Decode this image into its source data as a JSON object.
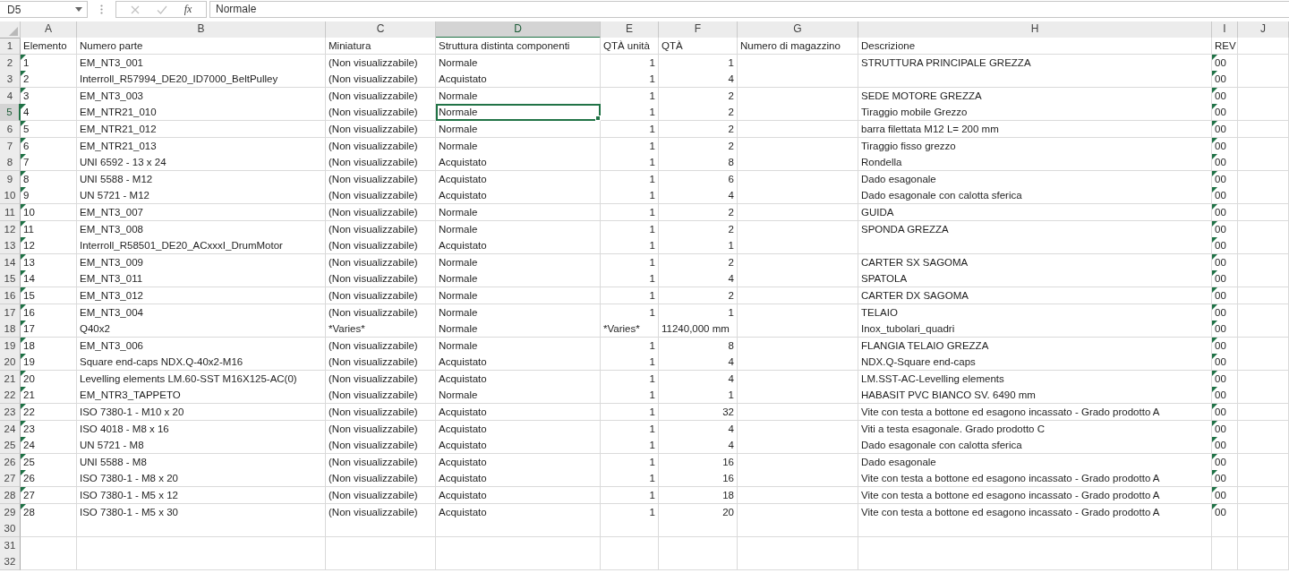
{
  "formula_bar": {
    "name_box": {
      "value": "D5"
    },
    "cancel_button": {
      "disabled": true
    },
    "enter_button": {
      "disabled": true
    },
    "function_button": {
      "label": "fx"
    },
    "formula": {
      "value": "Normale"
    }
  },
  "columns": [
    {
      "label": "A",
      "selected": false
    },
    {
      "label": "B",
      "selected": false
    },
    {
      "label": "C",
      "selected": false
    },
    {
      "label": "D",
      "selected": true
    },
    {
      "label": "E",
      "selected": false
    },
    {
      "label": "F",
      "selected": false
    },
    {
      "label": "G",
      "selected": false
    },
    {
      "label": "H",
      "selected": false
    },
    {
      "label": "I",
      "selected": false
    },
    {
      "label": "J",
      "selected": false
    }
  ],
  "rows": [
    {
      "number": "1",
      "selected": false,
      "cells": {
        "a": {
          "text": "Elemento",
          "kind": "text",
          "warning": false,
          "selected": false
        },
        "b": {
          "text": "Numero parte",
          "kind": "text",
          "warning": false,
          "selected": false
        },
        "c": {
          "text": "Miniatura",
          "kind": "text",
          "warning": false,
          "selected": false
        },
        "d": {
          "text": "Struttura distinta componenti",
          "kind": "text",
          "warning": false,
          "selected": false
        },
        "e": {
          "text": "QTÀ unità",
          "kind": "text",
          "warning": false,
          "selected": false
        },
        "f": {
          "text": "QTÀ",
          "kind": "text",
          "warning": false,
          "selected": false
        },
        "g": {
          "text": "Numero di magazzino",
          "kind": "text",
          "warning": false,
          "selected": false
        },
        "h": {
          "text": "Descrizione",
          "kind": "text",
          "warning": false,
          "selected": false
        },
        "i": {
          "text": "REV",
          "kind": "text",
          "warning": false,
          "selected": false
        }
      }
    },
    {
      "number": "2",
      "selected": false,
      "cells": {
        "a": {
          "text": "1",
          "kind": "text",
          "warning": true,
          "selected": false
        },
        "b": {
          "text": "EM_NT3_001",
          "kind": "text",
          "warning": false,
          "selected": false
        },
        "c": {
          "text": "(Non visualizzabile)",
          "kind": "text",
          "warning": false,
          "selected": false
        },
        "d": {
          "text": "Normale",
          "kind": "text",
          "warning": false,
          "selected": false
        },
        "e": {
          "text": "1",
          "kind": "number",
          "warning": false,
          "selected": false
        },
        "f": {
          "text": "1",
          "kind": "number",
          "warning": false,
          "selected": false
        },
        "h": {
          "text": "STRUTTURA PRINCIPALE GREZZA",
          "kind": "text",
          "warning": false,
          "selected": false
        },
        "i": {
          "text": "00",
          "kind": "text",
          "warning": true,
          "selected": false
        }
      }
    },
    {
      "number": "3",
      "selected": false,
      "cells": {
        "a": {
          "text": "2",
          "kind": "text",
          "warning": true,
          "selected": false
        },
        "b": {
          "text": "Interroll_R57994_DE20_ID7000_BeltPulley",
          "kind": "text",
          "warning": false,
          "selected": false
        },
        "c": {
          "text": "(Non visualizzabile)",
          "kind": "text",
          "warning": false,
          "selected": false
        },
        "d": {
          "text": "Acquistato",
          "kind": "text",
          "warning": false,
          "selected": false
        },
        "e": {
          "text": "1",
          "kind": "number",
          "warning": false,
          "selected": false
        },
        "f": {
          "text": "4",
          "kind": "number",
          "warning": false,
          "selected": false
        },
        "i": {
          "text": "00",
          "kind": "text",
          "warning": true,
          "selected": false
        }
      }
    },
    {
      "number": "4",
      "selected": false,
      "cells": {
        "a": {
          "text": "3",
          "kind": "text",
          "warning": true,
          "selected": false
        },
        "b": {
          "text": "EM_NT3_003",
          "kind": "text",
          "warning": false,
          "selected": false
        },
        "c": {
          "text": "(Non visualizzabile)",
          "kind": "text",
          "warning": false,
          "selected": false
        },
        "d": {
          "text": "Normale",
          "kind": "text",
          "warning": false,
          "selected": false
        },
        "e": {
          "text": "1",
          "kind": "number",
          "warning": false,
          "selected": false
        },
        "f": {
          "text": "2",
          "kind": "number",
          "warning": false,
          "selected": false
        },
        "h": {
          "text": "SEDE MOTORE GREZZA",
          "kind": "text",
          "warning": false,
          "selected": false
        },
        "i": {
          "text": "00",
          "kind": "text",
          "warning": true,
          "selected": false
        }
      }
    },
    {
      "number": "5",
      "selected": true,
      "cells": {
        "a": {
          "text": "4",
          "kind": "text",
          "warning": true,
          "selected": false
        },
        "b": {
          "text": "EM_NTR21_010",
          "kind": "text",
          "warning": false,
          "selected": false
        },
        "c": {
          "text": "(Non visualizzabile)",
          "kind": "text",
          "warning": false,
          "selected": false
        },
        "d": {
          "text": "Normale",
          "kind": "text",
          "warning": false,
          "selected": true
        },
        "e": {
          "text": "1",
          "kind": "number",
          "warning": false,
          "selected": false
        },
        "f": {
          "text": "2",
          "kind": "number",
          "warning": false,
          "selected": false
        },
        "h": {
          "text": "Tiraggio mobile Grezzo",
          "kind": "text",
          "warning": false,
          "selected": false
        },
        "i": {
          "text": "00",
          "kind": "text",
          "warning": true,
          "selected": false
        }
      }
    },
    {
      "number": "6",
      "selected": false,
      "cells": {
        "a": {
          "text": "5",
          "kind": "text",
          "warning": true,
          "selected": false
        },
        "b": {
          "text": "EM_NTR21_012",
          "kind": "text",
          "warning": false,
          "selected": false
        },
        "c": {
          "text": "(Non visualizzabile)",
          "kind": "text",
          "warning": false,
          "selected": false
        },
        "d": {
          "text": "Normale",
          "kind": "text",
          "warning": false,
          "selected": false
        },
        "e": {
          "text": "1",
          "kind": "number",
          "warning": false,
          "selected": false
        },
        "f": {
          "text": "2",
          "kind": "number",
          "warning": false,
          "selected": false
        },
        "h": {
          "text": "barra filettata M12 L= 200 mm",
          "kind": "text",
          "warning": false,
          "selected": false
        },
        "i": {
          "text": "00",
          "kind": "text",
          "warning": true,
          "selected": false
        }
      }
    },
    {
      "number": "7",
      "selected": false,
      "cells": {
        "a": {
          "text": "6",
          "kind": "text",
          "warning": true,
          "selected": false
        },
        "b": {
          "text": "EM_NTR21_013",
          "kind": "text",
          "warning": false,
          "selected": false
        },
        "c": {
          "text": "(Non visualizzabile)",
          "kind": "text",
          "warning": false,
          "selected": false
        },
        "d": {
          "text": "Normale",
          "kind": "text",
          "warning": false,
          "selected": false
        },
        "e": {
          "text": "1",
          "kind": "number",
          "warning": false,
          "selected": false
        },
        "f": {
          "text": "2",
          "kind": "number",
          "warning": false,
          "selected": false
        },
        "h": {
          "text": "Tiraggio fisso grezzo",
          "kind": "text",
          "warning": false,
          "selected": false
        },
        "i": {
          "text": "00",
          "kind": "text",
          "warning": true,
          "selected": false
        }
      }
    },
    {
      "number": "8",
      "selected": false,
      "cells": {
        "a": {
          "text": "7",
          "kind": "text",
          "warning": true,
          "selected": false
        },
        "b": {
          "text": "UNI 6592 - 13 x 24",
          "kind": "text",
          "warning": false,
          "selected": false
        },
        "c": {
          "text": "(Non visualizzabile)",
          "kind": "text",
          "warning": false,
          "selected": false
        },
        "d": {
          "text": "Acquistato",
          "kind": "text",
          "warning": false,
          "selected": false
        },
        "e": {
          "text": "1",
          "kind": "number",
          "warning": false,
          "selected": false
        },
        "f": {
          "text": "8",
          "kind": "number",
          "warning": false,
          "selected": false
        },
        "h": {
          "text": "Rondella",
          "kind": "text",
          "warning": false,
          "selected": false
        },
        "i": {
          "text": "00",
          "kind": "text",
          "warning": true,
          "selected": false
        }
      }
    },
    {
      "number": "9",
      "selected": false,
      "cells": {
        "a": {
          "text": "8",
          "kind": "text",
          "warning": true,
          "selected": false
        },
        "b": {
          "text": "UNI 5588 - M12",
          "kind": "text",
          "warning": false,
          "selected": false
        },
        "c": {
          "text": "(Non visualizzabile)",
          "kind": "text",
          "warning": false,
          "selected": false
        },
        "d": {
          "text": "Acquistato",
          "kind": "text",
          "warning": false,
          "selected": false
        },
        "e": {
          "text": "1",
          "kind": "number",
          "warning": false,
          "selected": false
        },
        "f": {
          "text": "6",
          "kind": "number",
          "warning": false,
          "selected": false
        },
        "h": {
          "text": "Dado esagonale",
          "kind": "text",
          "warning": false,
          "selected": false
        },
        "i": {
          "text": "00",
          "kind": "text",
          "warning": true,
          "selected": false
        }
      }
    },
    {
      "number": "10",
      "selected": false,
      "cells": {
        "a": {
          "text": "9",
          "kind": "text",
          "warning": true,
          "selected": false
        },
        "b": {
          "text": "UN 5721 - M12",
          "kind": "text",
          "warning": false,
          "selected": false
        },
        "c": {
          "text": "(Non visualizzabile)",
          "kind": "text",
          "warning": false,
          "selected": false
        },
        "d": {
          "text": "Acquistato",
          "kind": "text",
          "warning": false,
          "selected": false
        },
        "e": {
          "text": "1",
          "kind": "number",
          "warning": false,
          "selected": false
        },
        "f": {
          "text": "4",
          "kind": "number",
          "warning": false,
          "selected": false
        },
        "h": {
          "text": "Dado esagonale con calotta sferica",
          "kind": "text",
          "warning": false,
          "selected": false
        },
        "i": {
          "text": "00",
          "kind": "text",
          "warning": true,
          "selected": false
        }
      }
    },
    {
      "number": "11",
      "selected": false,
      "cells": {
        "a": {
          "text": "10",
          "kind": "text",
          "warning": true,
          "selected": false
        },
        "b": {
          "text": "EM_NT3_007",
          "kind": "text",
          "warning": false,
          "selected": false
        },
        "c": {
          "text": "(Non visualizzabile)",
          "kind": "text",
          "warning": false,
          "selected": false
        },
        "d": {
          "text": "Normale",
          "kind": "text",
          "warning": false,
          "selected": false
        },
        "e": {
          "text": "1",
          "kind": "number",
          "warning": false,
          "selected": false
        },
        "f": {
          "text": "2",
          "kind": "number",
          "warning": false,
          "selected": false
        },
        "h": {
          "text": "GUIDA",
          "kind": "text",
          "warning": false,
          "selected": false
        },
        "i": {
          "text": "00",
          "kind": "text",
          "warning": true,
          "selected": false
        }
      }
    },
    {
      "number": "12",
      "selected": false,
      "cells": {
        "a": {
          "text": "11",
          "kind": "text",
          "warning": true,
          "selected": false
        },
        "b": {
          "text": "EM_NT3_008",
          "kind": "text",
          "warning": false,
          "selected": false
        },
        "c": {
          "text": "(Non visualizzabile)",
          "kind": "text",
          "warning": false,
          "selected": false
        },
        "d": {
          "text": "Normale",
          "kind": "text",
          "warning": false,
          "selected": false
        },
        "e": {
          "text": "1",
          "kind": "number",
          "warning": false,
          "selected": false
        },
        "f": {
          "text": "2",
          "kind": "number",
          "warning": false,
          "selected": false
        },
        "h": {
          "text": "SPONDA GREZZA",
          "kind": "text",
          "warning": false,
          "selected": false
        },
        "i": {
          "text": "00",
          "kind": "text",
          "warning": true,
          "selected": false
        }
      }
    },
    {
      "number": "13",
      "selected": false,
      "cells": {
        "a": {
          "text": "12",
          "kind": "text",
          "warning": true,
          "selected": false
        },
        "b": {
          "text": "Interroll_R58501_DE20_ACxxxI_DrumMotor",
          "kind": "text",
          "warning": false,
          "selected": false
        },
        "c": {
          "text": "(Non visualizzabile)",
          "kind": "text",
          "warning": false,
          "selected": false
        },
        "d": {
          "text": "Acquistato",
          "kind": "text",
          "warning": false,
          "selected": false
        },
        "e": {
          "text": "1",
          "kind": "number",
          "warning": false,
          "selected": false
        },
        "f": {
          "text": "1",
          "kind": "number",
          "warning": false,
          "selected": false
        },
        "i": {
          "text": "00",
          "kind": "text",
          "warning": true,
          "selected": false
        }
      }
    },
    {
      "number": "14",
      "selected": false,
      "cells": {
        "a": {
          "text": "13",
          "kind": "text",
          "warning": true,
          "selected": false
        },
        "b": {
          "text": "EM_NT3_009",
          "kind": "text",
          "warning": false,
          "selected": false
        },
        "c": {
          "text": "(Non visualizzabile)",
          "kind": "text",
          "warning": false,
          "selected": false
        },
        "d": {
          "text": "Normale",
          "kind": "text",
          "warning": false,
          "selected": false
        },
        "e": {
          "text": "1",
          "kind": "number",
          "warning": false,
          "selected": false
        },
        "f": {
          "text": "2",
          "kind": "number",
          "warning": false,
          "selected": false
        },
        "h": {
          "text": "CARTER SX SAGOMA",
          "kind": "text",
          "warning": false,
          "selected": false
        },
        "i": {
          "text": "00",
          "kind": "text",
          "warning": true,
          "selected": false
        }
      }
    },
    {
      "number": "15",
      "selected": false,
      "cells": {
        "a": {
          "text": "14",
          "kind": "text",
          "warning": true,
          "selected": false
        },
        "b": {
          "text": "EM_NT3_011",
          "kind": "text",
          "warning": false,
          "selected": false
        },
        "c": {
          "text": "(Non visualizzabile)",
          "kind": "text",
          "warning": false,
          "selected": false
        },
        "d": {
          "text": "Normale",
          "kind": "text",
          "warning": false,
          "selected": false
        },
        "e": {
          "text": "1",
          "kind": "number",
          "warning": false,
          "selected": false
        },
        "f": {
          "text": "4",
          "kind": "number",
          "warning": false,
          "selected": false
        },
        "h": {
          "text": "SPATOLA",
          "kind": "text",
          "warning": false,
          "selected": false
        },
        "i": {
          "text": "00",
          "kind": "text",
          "warning": true,
          "selected": false
        }
      }
    },
    {
      "number": "16",
      "selected": false,
      "cells": {
        "a": {
          "text": "15",
          "kind": "text",
          "warning": true,
          "selected": false
        },
        "b": {
          "text": "EM_NT3_012",
          "kind": "text",
          "warning": false,
          "selected": false
        },
        "c": {
          "text": "(Non visualizzabile)",
          "kind": "text",
          "warning": false,
          "selected": false
        },
        "d": {
          "text": "Normale",
          "kind": "text",
          "warning": false,
          "selected": false
        },
        "e": {
          "text": "1",
          "kind": "number",
          "warning": false,
          "selected": false
        },
        "f": {
          "text": "2",
          "kind": "number",
          "warning": false,
          "selected": false
        },
        "h": {
          "text": "CARTER DX SAGOMA",
          "kind": "text",
          "warning": false,
          "selected": false
        },
        "i": {
          "text": "00",
          "kind": "text",
          "warning": true,
          "selected": false
        }
      }
    },
    {
      "number": "17",
      "selected": false,
      "cells": {
        "a": {
          "text": "16",
          "kind": "text",
          "warning": true,
          "selected": false
        },
        "b": {
          "text": "EM_NT3_004",
          "kind": "text",
          "warning": false,
          "selected": false
        },
        "c": {
          "text": "(Non visualizzabile)",
          "kind": "text",
          "warning": false,
          "selected": false
        },
        "d": {
          "text": "Normale",
          "kind": "text",
          "warning": false,
          "selected": false
        },
        "e": {
          "text": "1",
          "kind": "number",
          "warning": false,
          "selected": false
        },
        "f": {
          "text": "1",
          "kind": "number",
          "warning": false,
          "selected": false
        },
        "h": {
          "text": "TELAIO",
          "kind": "text",
          "warning": false,
          "selected": false
        },
        "i": {
          "text": "00",
          "kind": "text",
          "warning": true,
          "selected": false
        }
      }
    },
    {
      "number": "18",
      "selected": false,
      "cells": {
        "a": {
          "text": "17",
          "kind": "text",
          "warning": true,
          "selected": false
        },
        "b": {
          "text": "Q40x2",
          "kind": "text",
          "warning": false,
          "selected": false
        },
        "c": {
          "text": "*Varies*",
          "kind": "text",
          "warning": false,
          "selected": false
        },
        "d": {
          "text": "Normale",
          "kind": "text",
          "warning": false,
          "selected": false
        },
        "e": {
          "text": "*Varies*",
          "kind": "text",
          "warning": false,
          "selected": false
        },
        "f": {
          "text": "11240,000 mm",
          "kind": "text",
          "warning": false,
          "selected": false
        },
        "h": {
          "text": "Inox_tubolari_quadri",
          "kind": "text",
          "warning": false,
          "selected": false
        },
        "i": {
          "text": "00",
          "kind": "text",
          "warning": true,
          "selected": false
        }
      }
    },
    {
      "number": "19",
      "selected": false,
      "cells": {
        "a": {
          "text": "18",
          "kind": "text",
          "warning": true,
          "selected": false
        },
        "b": {
          "text": "EM_NT3_006",
          "kind": "text",
          "warning": false,
          "selected": false
        },
        "c": {
          "text": "(Non visualizzabile)",
          "kind": "text",
          "warning": false,
          "selected": false
        },
        "d": {
          "text": "Normale",
          "kind": "text",
          "warning": false,
          "selected": false
        },
        "e": {
          "text": "1",
          "kind": "number",
          "warning": false,
          "selected": false
        },
        "f": {
          "text": "8",
          "kind": "number",
          "warning": false,
          "selected": false
        },
        "h": {
          "text": "FLANGIA TELAIO GREZZA",
          "kind": "text",
          "warning": false,
          "selected": false
        },
        "i": {
          "text": "00",
          "kind": "text",
          "warning": true,
          "selected": false
        }
      }
    },
    {
      "number": "20",
      "selected": false,
      "cells": {
        "a": {
          "text": "19",
          "kind": "text",
          "warning": true,
          "selected": false
        },
        "b": {
          "text": "Square end-caps NDX.Q-40x2-M16",
          "kind": "text",
          "warning": false,
          "selected": false
        },
        "c": {
          "text": "(Non visualizzabile)",
          "kind": "text",
          "warning": false,
          "selected": false
        },
        "d": {
          "text": "Acquistato",
          "kind": "text",
          "warning": false,
          "selected": false
        },
        "e": {
          "text": "1",
          "kind": "number",
          "warning": false,
          "selected": false
        },
        "f": {
          "text": "4",
          "kind": "number",
          "warning": false,
          "selected": false
        },
        "h": {
          "text": "NDX.Q-Square end-caps",
          "kind": "text",
          "warning": false,
          "selected": false
        },
        "i": {
          "text": "00",
          "kind": "text",
          "warning": true,
          "selected": false
        }
      }
    },
    {
      "number": "21",
      "selected": false,
      "cells": {
        "a": {
          "text": "20",
          "kind": "text",
          "warning": true,
          "selected": false
        },
        "b": {
          "text": "Levelling elements LM.60-SST M16X125-AC(0)",
          "kind": "text",
          "warning": false,
          "selected": false
        },
        "c": {
          "text": "(Non visualizzabile)",
          "kind": "text",
          "warning": false,
          "selected": false
        },
        "d": {
          "text": "Acquistato",
          "kind": "text",
          "warning": false,
          "selected": false
        },
        "e": {
          "text": "1",
          "kind": "number",
          "warning": false,
          "selected": false
        },
        "f": {
          "text": "4",
          "kind": "number",
          "warning": false,
          "selected": false
        },
        "h": {
          "text": "LM.SST-AC-Levelling elements",
          "kind": "text",
          "warning": false,
          "selected": false
        },
        "i": {
          "text": "00",
          "kind": "text",
          "warning": true,
          "selected": false
        }
      }
    },
    {
      "number": "22",
      "selected": false,
      "cells": {
        "a": {
          "text": "21",
          "kind": "text",
          "warning": true,
          "selected": false
        },
        "b": {
          "text": "EM_NTR3_TAPPETO",
          "kind": "text",
          "warning": false,
          "selected": false
        },
        "c": {
          "text": "(Non visualizzabile)",
          "kind": "text",
          "warning": false,
          "selected": false
        },
        "d": {
          "text": "Normale",
          "kind": "text",
          "warning": false,
          "selected": false
        },
        "e": {
          "text": "1",
          "kind": "number",
          "warning": false,
          "selected": false
        },
        "f": {
          "text": "1",
          "kind": "number",
          "warning": false,
          "selected": false
        },
        "h": {
          "text": "HABASIT PVC BIANCO SV. 6490 mm",
          "kind": "text",
          "warning": false,
          "selected": false
        },
        "i": {
          "text": "00",
          "kind": "text",
          "warning": true,
          "selected": false
        }
      }
    },
    {
      "number": "23",
      "selected": false,
      "cells": {
        "a": {
          "text": "22",
          "kind": "text",
          "warning": true,
          "selected": false
        },
        "b": {
          "text": "ISO 7380-1 - M10 x 20",
          "kind": "text",
          "warning": false,
          "selected": false
        },
        "c": {
          "text": "(Non visualizzabile)",
          "kind": "text",
          "warning": false,
          "selected": false
        },
        "d": {
          "text": "Acquistato",
          "kind": "text",
          "warning": false,
          "selected": false
        },
        "e": {
          "text": "1",
          "kind": "number",
          "warning": false,
          "selected": false
        },
        "f": {
          "text": "32",
          "kind": "number",
          "warning": false,
          "selected": false
        },
        "h": {
          "text": "Vite con testa a bottone ed esagono incassato - Grado prodotto A",
          "kind": "text",
          "warning": false,
          "selected": false
        },
        "i": {
          "text": "00",
          "kind": "text",
          "warning": true,
          "selected": false
        }
      }
    },
    {
      "number": "24",
      "selected": false,
      "cells": {
        "a": {
          "text": "23",
          "kind": "text",
          "warning": true,
          "selected": false
        },
        "b": {
          "text": "ISO 4018 - M8 x 16",
          "kind": "text",
          "warning": false,
          "selected": false
        },
        "c": {
          "text": "(Non visualizzabile)",
          "kind": "text",
          "warning": false,
          "selected": false
        },
        "d": {
          "text": "Acquistato",
          "kind": "text",
          "warning": false,
          "selected": false
        },
        "e": {
          "text": "1",
          "kind": "number",
          "warning": false,
          "selected": false
        },
        "f": {
          "text": "4",
          "kind": "number",
          "warning": false,
          "selected": false
        },
        "h": {
          "text": "Viti a testa esagonale. Grado prodotto C",
          "kind": "text",
          "warning": false,
          "selected": false
        },
        "i": {
          "text": "00",
          "kind": "text",
          "warning": true,
          "selected": false
        }
      }
    },
    {
      "number": "25",
      "selected": false,
      "cells": {
        "a": {
          "text": "24",
          "kind": "text",
          "warning": true,
          "selected": false
        },
        "b": {
          "text": "UN 5721 - M8",
          "kind": "text",
          "warning": false,
          "selected": false
        },
        "c": {
          "text": "(Non visualizzabile)",
          "kind": "text",
          "warning": false,
          "selected": false
        },
        "d": {
          "text": "Acquistato",
          "kind": "text",
          "warning": false,
          "selected": false
        },
        "e": {
          "text": "1",
          "kind": "number",
          "warning": false,
          "selected": false
        },
        "f": {
          "text": "4",
          "kind": "number",
          "warning": false,
          "selected": false
        },
        "h": {
          "text": "Dado esagonale con calotta sferica",
          "kind": "text",
          "warning": false,
          "selected": false
        },
        "i": {
          "text": "00",
          "kind": "text",
          "warning": true,
          "selected": false
        }
      }
    },
    {
      "number": "26",
      "selected": false,
      "cells": {
        "a": {
          "text": "25",
          "kind": "text",
          "warning": true,
          "selected": false
        },
        "b": {
          "text": "UNI 5588 - M8",
          "kind": "text",
          "warning": false,
          "selected": false
        },
        "c": {
          "text": "(Non visualizzabile)",
          "kind": "text",
          "warning": false,
          "selected": false
        },
        "d": {
          "text": "Acquistato",
          "kind": "text",
          "warning": false,
          "selected": false
        },
        "e": {
          "text": "1",
          "kind": "number",
          "warning": false,
          "selected": false
        },
        "f": {
          "text": "16",
          "kind": "number",
          "warning": false,
          "selected": false
        },
        "h": {
          "text": "Dado esagonale",
          "kind": "text",
          "warning": false,
          "selected": false
        },
        "i": {
          "text": "00",
          "kind": "text",
          "warning": true,
          "selected": false
        }
      }
    },
    {
      "number": "27",
      "selected": false,
      "cells": {
        "a": {
          "text": "26",
          "kind": "text",
          "warning": true,
          "selected": false
        },
        "b": {
          "text": "ISO 7380-1 - M8 x 20",
          "kind": "text",
          "warning": false,
          "selected": false
        },
        "c": {
          "text": "(Non visualizzabile)",
          "kind": "text",
          "warning": false,
          "selected": false
        },
        "d": {
          "text": "Acquistato",
          "kind": "text",
          "warning": false,
          "selected": false
        },
        "e": {
          "text": "1",
          "kind": "number",
          "warning": false,
          "selected": false
        },
        "f": {
          "text": "16",
          "kind": "number",
          "warning": false,
          "selected": false
        },
        "h": {
          "text": "Vite con testa a bottone ed esagono incassato - Grado prodotto A",
          "kind": "text",
          "warning": false,
          "selected": false
        },
        "i": {
          "text": "00",
          "kind": "text",
          "warning": true,
          "selected": false
        }
      }
    },
    {
      "number": "28",
      "selected": false,
      "cells": {
        "a": {
          "text": "27",
          "kind": "text",
          "warning": true,
          "selected": false
        },
        "b": {
          "text": "ISO 7380-1 - M5 x 12",
          "kind": "text",
          "warning": false,
          "selected": false
        },
        "c": {
          "text": "(Non visualizzabile)",
          "kind": "text",
          "warning": false,
          "selected": false
        },
        "d": {
          "text": "Acquistato",
          "kind": "text",
          "warning": false,
          "selected": false
        },
        "e": {
          "text": "1",
          "kind": "number",
          "warning": false,
          "selected": false
        },
        "f": {
          "text": "18",
          "kind": "number",
          "warning": false,
          "selected": false
        },
        "h": {
          "text": "Vite con testa a bottone ed esagono incassato - Grado prodotto A",
          "kind": "text",
          "warning": false,
          "selected": false
        },
        "i": {
          "text": "00",
          "kind": "text",
          "warning": true,
          "selected": false
        }
      }
    },
    {
      "number": "29",
      "selected": false,
      "cells": {
        "a": {
          "text": "28",
          "kind": "text",
          "warning": true,
          "selected": false
        },
        "b": {
          "text": "ISO 7380-1 - M5 x 30",
          "kind": "text",
          "warning": false,
          "selected": false
        },
        "c": {
          "text": "(Non visualizzabile)",
          "kind": "text",
          "warning": false,
          "selected": false
        },
        "d": {
          "text": "Acquistato",
          "kind": "text",
          "warning": false,
          "selected": false
        },
        "e": {
          "text": "1",
          "kind": "number",
          "warning": false,
          "selected": false
        },
        "f": {
          "text": "20",
          "kind": "number",
          "warning": false,
          "selected": false
        },
        "h": {
          "text": "Vite con testa a bottone ed esagono incassato - Grado prodotto A",
          "kind": "text",
          "warning": false,
          "selected": false
        },
        "i": {
          "text": "00",
          "kind": "text",
          "warning": true,
          "selected": false
        }
      }
    },
    {
      "number": "30",
      "selected": false
    },
    {
      "number": "31",
      "selected": false
    },
    {
      "number": "32",
      "selected": false
    }
  ]
}
